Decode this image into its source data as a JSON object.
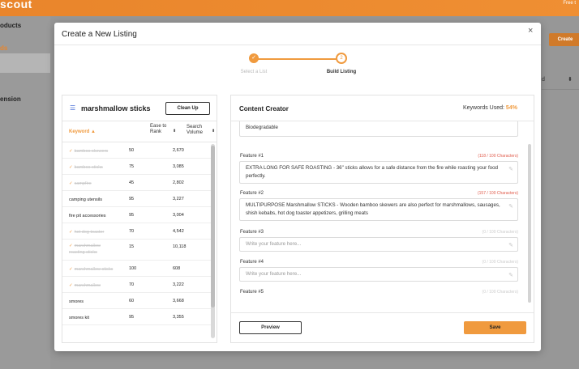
{
  "app": {
    "logo": "scout",
    "topright": "Free t"
  },
  "sidebar": {
    "items": [
      {
        "label": "oducts"
      },
      {
        "label": "ds"
      },
      {
        "label": "ension"
      }
    ]
  },
  "background": {
    "create_label": "Create",
    "dropdown_value": "d",
    "caret": "⬍"
  },
  "modal": {
    "title": "Create a New Listing",
    "close": "×"
  },
  "stepper": {
    "steps": [
      {
        "label": "Select a List",
        "icon": "✓"
      },
      {
        "label": "Build Listing",
        "number": "2"
      }
    ]
  },
  "keywords": {
    "icon": "list-icon",
    "title": "marshmallow sticks",
    "cleanup_label": "Clean Up",
    "columns": {
      "keyword": "Keyword",
      "keyword_sort": "▲",
      "ease": "Ease to Rank",
      "volume": "Search Volume",
      "sort": "⬍"
    },
    "rows": [
      {
        "name": "bamboo skewers",
        "ease": "50",
        "volume": "2,670",
        "used": true
      },
      {
        "name": "bamboo sticks",
        "ease": "75",
        "volume": "3,085",
        "used": true
      },
      {
        "name": "campfire",
        "ease": "45",
        "volume": "2,802",
        "used": true
      },
      {
        "name": "camping utensils",
        "ease": "95",
        "volume": "3,227",
        "used": false
      },
      {
        "name": "fire pit accessories",
        "ease": "95",
        "volume": "3,004",
        "used": false
      },
      {
        "name": "hot dog toaster",
        "ease": "70",
        "volume": "4,542",
        "used": true
      },
      {
        "name": "marshmallow roasting sticks",
        "ease": "15",
        "volume": "10,118",
        "used": true
      },
      {
        "name": "marshmallow sticks",
        "ease": "100",
        "volume": "608",
        "used": true
      },
      {
        "name": "marshmallow",
        "ease": "70",
        "volume": "3,222",
        "used": true
      },
      {
        "name": "smores",
        "ease": "60",
        "volume": "3,668",
        "used": false
      },
      {
        "name": "smores kit",
        "ease": "95",
        "volume": "3,355",
        "used": false
      }
    ]
  },
  "content_creator": {
    "title": "Content Creator",
    "keywords_used_label": "Keywords Used:",
    "keywords_used_value": "54%",
    "top_text": "Biodegradable",
    "features": [
      {
        "label": "Feature #1",
        "count": "(118 / 100 Characters)",
        "value": "EXTRA LONG FOR SAFE ROASTING - 36\" sticks allows for a safe distance from the fire while roasting your food perfectly."
      },
      {
        "label": "Feature #2",
        "count": "(157 / 100 Characters)",
        "value": "MULTIPURPOSE Marshmallow STICKS - Wooden bamboo skewers are also perfect for marshmallows, sausages, shish kebabs, hot dog toaster appetizers, grilling meats"
      },
      {
        "label": "Feature #3",
        "count": "(0 / 100 Characters)",
        "placeholder": "Write your feature here..."
      },
      {
        "label": "Feature #4",
        "count": "(0 / 100 Characters)",
        "placeholder": "Write your feature here..."
      },
      {
        "label": "Feature #5",
        "count": "(0 / 100 Characters)"
      }
    ],
    "edit_icon": "pencil-icon",
    "preview_label": "Preview",
    "save_label": "Save"
  },
  "colors": {
    "accent": "#f09a3e",
    "topbar": "#ef8f33",
    "over_limit": "#e05a4a",
    "check": "#f09a3e"
  }
}
